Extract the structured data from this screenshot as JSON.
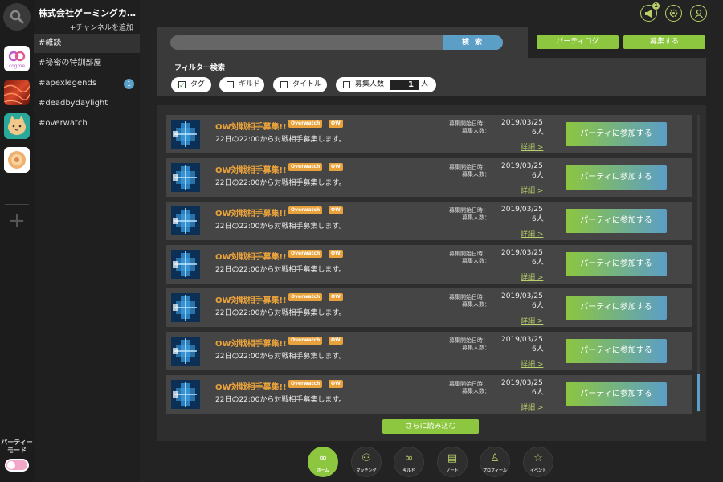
{
  "rail": {
    "apps": [
      {
        "name": "cogme",
        "text": "cogme"
      },
      {
        "name": "apex",
        "text": ""
      },
      {
        "name": "cat",
        "text": ""
      },
      {
        "name": "flower",
        "text": ""
      }
    ],
    "party_mode_label": "パーティー\nモード"
  },
  "sidebar": {
    "org_name": "株式会社ゲーミングカ…",
    "add_channel": "+チャンネルを追加",
    "channels": [
      {
        "label": "#雑談",
        "badge": ""
      },
      {
        "label": "#秘密の特訓部屋",
        "badge": ""
      },
      {
        "label": "#apexlegends",
        "badge": "1"
      },
      {
        "label": "#deadbydaylight",
        "badge": ""
      },
      {
        "label": "#overwatch",
        "badge": ""
      }
    ]
  },
  "header": {
    "notification_count": "1"
  },
  "search": {
    "button_label": "検 索",
    "placeholder": ""
  },
  "actions": {
    "party_log": "パーティログ",
    "recruit": "募集する"
  },
  "filter": {
    "title": "フィルター検索",
    "chips": [
      {
        "label": "タグ",
        "checked": true
      },
      {
        "label": "ギルド",
        "checked": false
      },
      {
        "label": "タイトル",
        "checked": false
      },
      {
        "label": "募集人数",
        "checked": false
      }
    ],
    "people_count": "1",
    "people_unit": "人"
  },
  "recruitments": [
    {
      "title": "OW対戦相手募集!!",
      "tags": [
        "Overwatch",
        "OW"
      ],
      "desc": "22日の22:00から対戦相手募集します。",
      "start_label": "募集開始日時：",
      "count_label": "募集人数：",
      "date": "2019/03/25",
      "count": "6人",
      "detail": "詳細 >",
      "join": "パーティに参加する"
    },
    {
      "title": "OW対戦相手募集!!",
      "tags": [
        "Overwatch",
        "OW"
      ],
      "desc": "22日の22:00から対戦相手募集します。",
      "start_label": "募集開始日時：",
      "count_label": "募集人数：",
      "date": "2019/03/25",
      "count": "6人",
      "detail": "詳細 >",
      "join": "パーティに参加する"
    },
    {
      "title": "OW対戦相手募集!!",
      "tags": [
        "Overwatch",
        "OW"
      ],
      "desc": "22日の22:00から対戦相手募集します。",
      "start_label": "募集開始日時：",
      "count_label": "募集人数：",
      "date": "2019/03/25",
      "count": "6人",
      "detail": "詳細 >",
      "join": "パーティに参加する"
    },
    {
      "title": "OW対戦相手募集!!",
      "tags": [
        "Overwatch",
        "OW"
      ],
      "desc": "22日の22:00から対戦相手募集します。",
      "start_label": "募集開始日時：",
      "count_label": "募集人数：",
      "date": "2019/03/25",
      "count": "6人",
      "detail": "詳細 >",
      "join": "パーティに参加する"
    },
    {
      "title": "OW対戦相手募集!!",
      "tags": [
        "Overwatch",
        "OW"
      ],
      "desc": "22日の22:00から対戦相手募集します。",
      "start_label": "募集開始日時：",
      "count_label": "募集人数：",
      "date": "2019/03/25",
      "count": "6人",
      "detail": "詳細 >",
      "join": "パーティに参加する"
    },
    {
      "title": "OW対戦相手募集!!",
      "tags": [
        "Overwatch",
        "OW"
      ],
      "desc": "22日の22:00から対戦相手募集します。",
      "start_label": "募集開始日時：",
      "count_label": "募集人数：",
      "date": "2019/03/25",
      "count": "6人",
      "detail": "詳細 >",
      "join": "パーティに参加する"
    },
    {
      "title": "OW対戦相手募集!!",
      "tags": [
        "Overwatch",
        "OW"
      ],
      "desc": "22日の22:00から対戦相手募集します。",
      "start_label": "募集開始日時：",
      "count_label": "募集人数：",
      "date": "2019/03/25",
      "count": "6人",
      "detail": "詳細 >",
      "join": "パーティに参加する"
    }
  ],
  "load_more": "さらに読み込む",
  "bottom_nav": [
    {
      "label": "ホーム",
      "icon": "home-icon",
      "glyph": "∞",
      "active": true
    },
    {
      "label": "マッチング",
      "icon": "matching-icon",
      "glyph": "⚇",
      "active": false
    },
    {
      "label": "ギルド",
      "icon": "guild-icon",
      "glyph": "∞",
      "active": false
    },
    {
      "label": "ノート",
      "icon": "note-icon",
      "glyph": "▤",
      "active": false
    },
    {
      "label": "プロフィール",
      "icon": "profile-icon",
      "glyph": "♙",
      "active": false
    },
    {
      "label": "イベント",
      "icon": "event-icon",
      "glyph": "☆",
      "active": false
    }
  ],
  "colors": {
    "accent_green": "#8dc63f",
    "accent_blue": "#5b9ec6",
    "title_orange": "#e9a23b"
  }
}
